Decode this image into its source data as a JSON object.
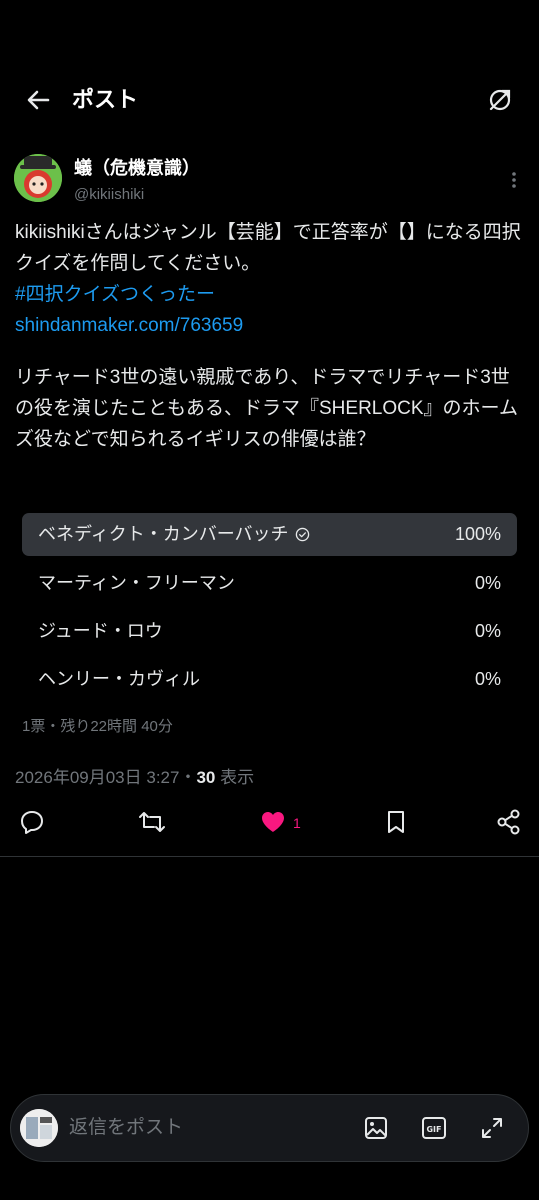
{
  "header": {
    "title": "ポスト"
  },
  "author": {
    "name": "蟻（危機意識）",
    "handle": "@kikiishiki"
  },
  "post": {
    "text_line1": "kikiishikiさんはジャンル【芸能】で正答率が【】になる四択クイズを作問してください。",
    "hashtag": "#四択クイズつくったー",
    "link": "shindanmaker.com/763659",
    "question": "リチャード3世の遠い親戚であり、ドラマでリチャード3世の役を演じたこともある、ドラマ『SHERLOCK』のホームズ役などで知られるイギリスの俳優は誰？"
  },
  "poll": {
    "options": [
      {
        "label": "ベネディクト・カンバーバッチ",
        "percent": "100%",
        "selected": true
      },
      {
        "label": "マーティン・フリーマン",
        "percent": "0%"
      },
      {
        "label": "ジュード・ロウ",
        "percent": "0%"
      },
      {
        "label": "ヘンリー・カヴィル",
        "percent": "0%"
      }
    ],
    "meta": "1票・残り22時間 40分"
  },
  "meta": {
    "timestamp": "2026年09月03日 3:27・",
    "views": "30",
    "views_label": " 表示"
  },
  "actions": {
    "like_count": "1"
  },
  "reply": {
    "placeholder": "返信をポスト"
  },
  "colors": {
    "accent": "#1d9bf0",
    "like": "#f91880",
    "muted": "#71767b"
  },
  "icons": [
    "back-arrow-icon",
    "expand-icon",
    "more-icon",
    "check-circle-icon",
    "reply-icon",
    "retweet-icon",
    "heart-icon",
    "bookmark-icon",
    "share-icon",
    "image-icon",
    "gif-icon",
    "expand-arrows-icon"
  ]
}
